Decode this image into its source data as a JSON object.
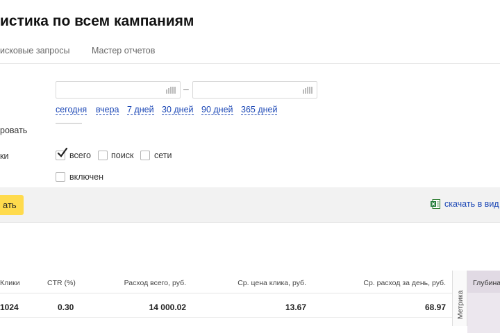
{
  "page": {
    "title": "истика по всем кампаниям"
  },
  "tabs": [
    {
      "label": "исковые запросы"
    },
    {
      "label": "Мастер отчетов"
    }
  ],
  "period": {
    "date_from_value": "",
    "date_to_value": "",
    "dash": "–",
    "presets": [
      {
        "label": "сегодня"
      },
      {
        "label": "вчера"
      },
      {
        "label": "7 дней"
      },
      {
        "label": "30 дней"
      },
      {
        "label": "90 дней"
      },
      {
        "label": "365 дней"
      }
    ]
  },
  "labels": {
    "group": "ровать",
    "platforms": "ки"
  },
  "platforms": {
    "all": {
      "label": "всего",
      "checked": true
    },
    "search": {
      "label": "поиск",
      "checked": false
    },
    "networks": {
      "label": "сети",
      "checked": false
    }
  },
  "extra": {
    "enabled": {
      "label": "включен",
      "checked": false
    }
  },
  "actions": {
    "show_button": "ать",
    "download_link": "скачать в вид"
  },
  "table": {
    "headers": {
      "clicks": "Клики",
      "ctr": "CTR (%)",
      "spend_total": "Расход всего, руб.",
      "avg_cpc": "Ср. цена клика, руб.",
      "avg_daily_spend": "Ср. расход за день, руб.",
      "metrika": "Метрика",
      "depth": "Глубина"
    },
    "row": {
      "clicks": "1024",
      "ctr": "0.30",
      "spend_total": "14 000.02",
      "avg_cpc": "13.67",
      "avg_daily_spend": "68.97"
    }
  },
  "colors": {
    "accent_yellow": "#ffdb4d",
    "link_blue": "#1a46b5",
    "panel_gray": "#f2f2f2",
    "depth_col": "#ece7ee"
  },
  "icons": {
    "calendar": "calendar-icon",
    "checkmark": "checkmark-icon",
    "excel": "excel-icon"
  }
}
